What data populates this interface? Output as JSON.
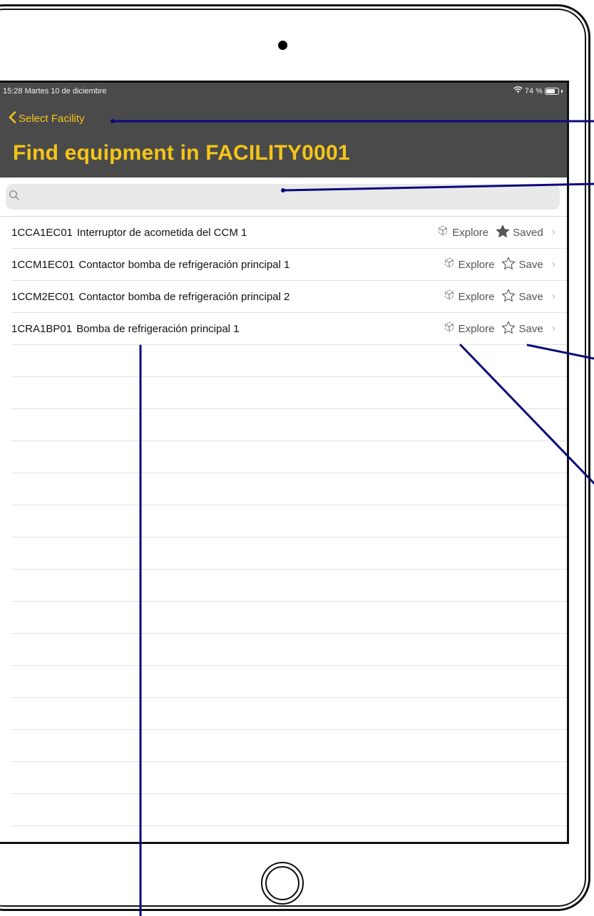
{
  "status": {
    "time_date": "15:28  Martes 10 de diciembre",
    "battery": "74 %",
    "battery_level_percent": 74
  },
  "nav": {
    "back_label": "Select Facility",
    "title": "Find equipment in FACILITY0001"
  },
  "search": {
    "value": ""
  },
  "equipment": [
    {
      "code": "1CCA1EC01",
      "description": "Interruptor de acometida del CCM 1",
      "explore_label": "Explore",
      "save_label": "Saved",
      "saved": true
    },
    {
      "code": "1CCM1EC01",
      "description": "Contactor bomba de refrigeración principal 1",
      "explore_label": "Explore",
      "save_label": "Save",
      "saved": false
    },
    {
      "code": "1CCM2EC01",
      "description": "Contactor bomba de refrigeración principal 2",
      "explore_label": "Explore",
      "save_label": "Save",
      "saved": false
    },
    {
      "code": "1CRA1BP01",
      "description": "Bomba de refrigeración principal 1",
      "explore_label": "Explore",
      "save_label": "Save",
      "saved": false
    }
  ],
  "colors": {
    "nav_background": "#4a4a4a",
    "accent": "#f5c518",
    "annotation": "#0a0a7a"
  }
}
